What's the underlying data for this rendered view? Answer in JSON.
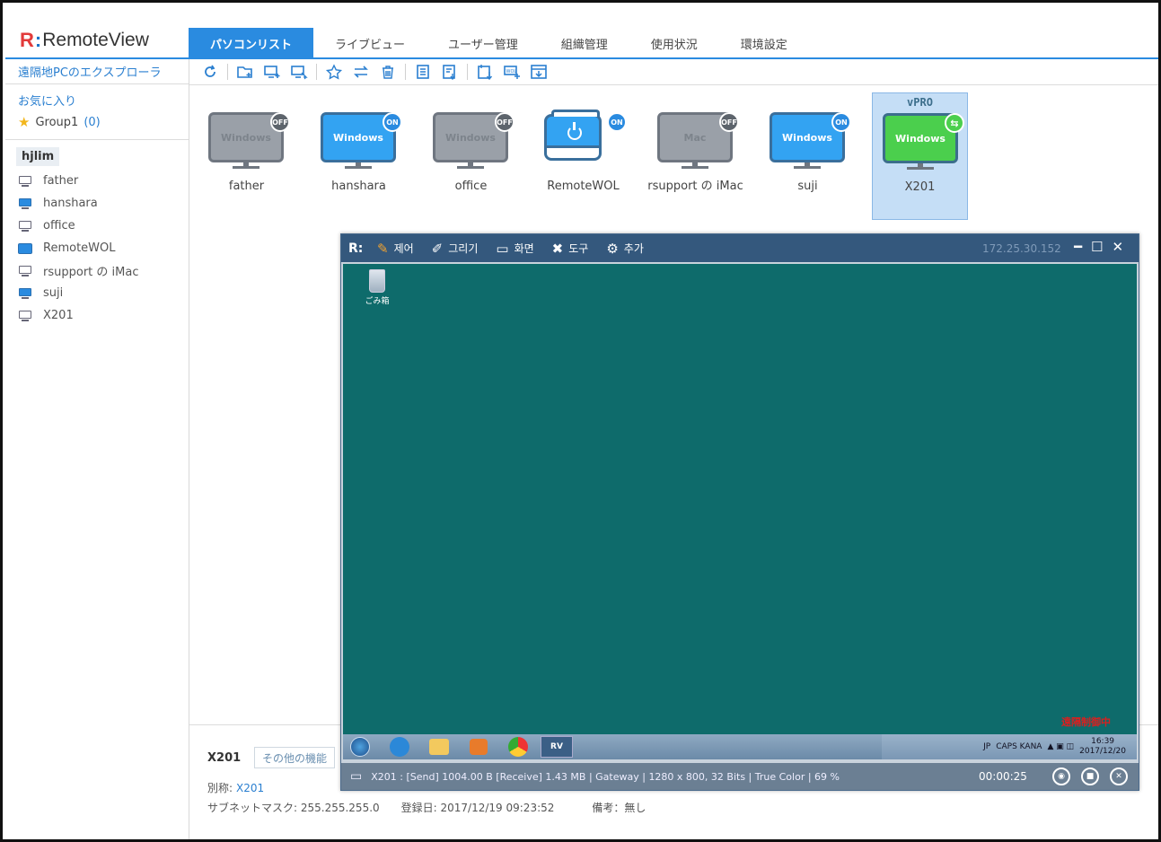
{
  "app": {
    "logo_r": "R",
    "logo_colon": ":",
    "logo_text": "RemoteView"
  },
  "tabs": [
    {
      "label": "パソコンリスト",
      "active": true
    },
    {
      "label": "ライブビュー"
    },
    {
      "label": "ユーザー管理"
    },
    {
      "label": "組織管理"
    },
    {
      "label": "使用状況"
    },
    {
      "label": "環境設定"
    }
  ],
  "sidebar": {
    "title": "遠隔地PCのエクスプローラ",
    "favorites_title": "お気に入り",
    "favorite_group": {
      "name": "Group1",
      "count": "(0)"
    },
    "group_head": "hjlim",
    "items": [
      {
        "label": "father",
        "icon": "monitor-off-icon"
      },
      {
        "label": "hanshara",
        "icon": "monitor-on-icon"
      },
      {
        "label": "office",
        "icon": "monitor-off-icon"
      },
      {
        "label": "RemoteWOL",
        "icon": "wol-device-icon"
      },
      {
        "label": "rsupport の iMac",
        "icon": "monitor-off-icon"
      },
      {
        "label": "suji",
        "icon": "monitor-on-icon"
      },
      {
        "label": "X201",
        "icon": "monitor-off-icon"
      }
    ]
  },
  "toolbar": {
    "icons": [
      "refresh-icon",
      "add-folder-icon",
      "add-pc-icon",
      "select-pc-icon",
      "favorite-icon",
      "swap-icon",
      "delete-icon",
      "document-icon",
      "export-icon",
      "import-icon",
      "wol-add-icon",
      "download-icon"
    ]
  },
  "devices": [
    {
      "name": "father",
      "os": "Windows",
      "status": "OFF"
    },
    {
      "name": "hanshara",
      "os": "Windows",
      "status": "ON"
    },
    {
      "name": "office",
      "os": "Windows",
      "status": "OFF"
    },
    {
      "name": "RemoteWOL",
      "os": "",
      "status": "ON"
    },
    {
      "name": "rsupport の iMac",
      "os": "Mac",
      "status": "OFF"
    },
    {
      "name": "suji",
      "os": "Windows",
      "status": "ON"
    },
    {
      "name": "X201",
      "os": "Windows",
      "status": "connected",
      "badge_top": "vPRO"
    }
  ],
  "info": {
    "name": "X201",
    "more_button": "その他の機能",
    "alias_label": "別称:",
    "alias_value": "X201",
    "subnet": "サブネットマスク: 255.255.255.0",
    "registered": "登録日: 2017/12/19 09:23:52",
    "note": "備考：無し"
  },
  "remote": {
    "logo": "R:",
    "menus": [
      {
        "label": "제어",
        "icon": "control-icon"
      },
      {
        "label": "그리기",
        "icon": "pen-icon"
      },
      {
        "label": "화면",
        "icon": "screen-icon"
      },
      {
        "label": "도구",
        "icon": "tools-icon"
      },
      {
        "label": "추가",
        "icon": "gear-icon"
      }
    ],
    "ip": "172.25.30.152",
    "recycle_bin": "ごみ箱",
    "remote_note": "遠隔制御中",
    "tray_ime": "JP",
    "tray_caps": "CAPS KANA",
    "clock_time": "16:39",
    "clock_date": "2017/12/20",
    "status_line": "X201 : [Send] 1004.00 B  [Receive] 1.43 MB | Gateway | 1280 x 800, 32 Bits | True Color | 69 %",
    "timer": "00:00:25",
    "rv_task": "RV"
  },
  "colors": {
    "accent": "#2a8be0",
    "remote_bar": "#34587d",
    "desktop": "#0e6b6b"
  }
}
